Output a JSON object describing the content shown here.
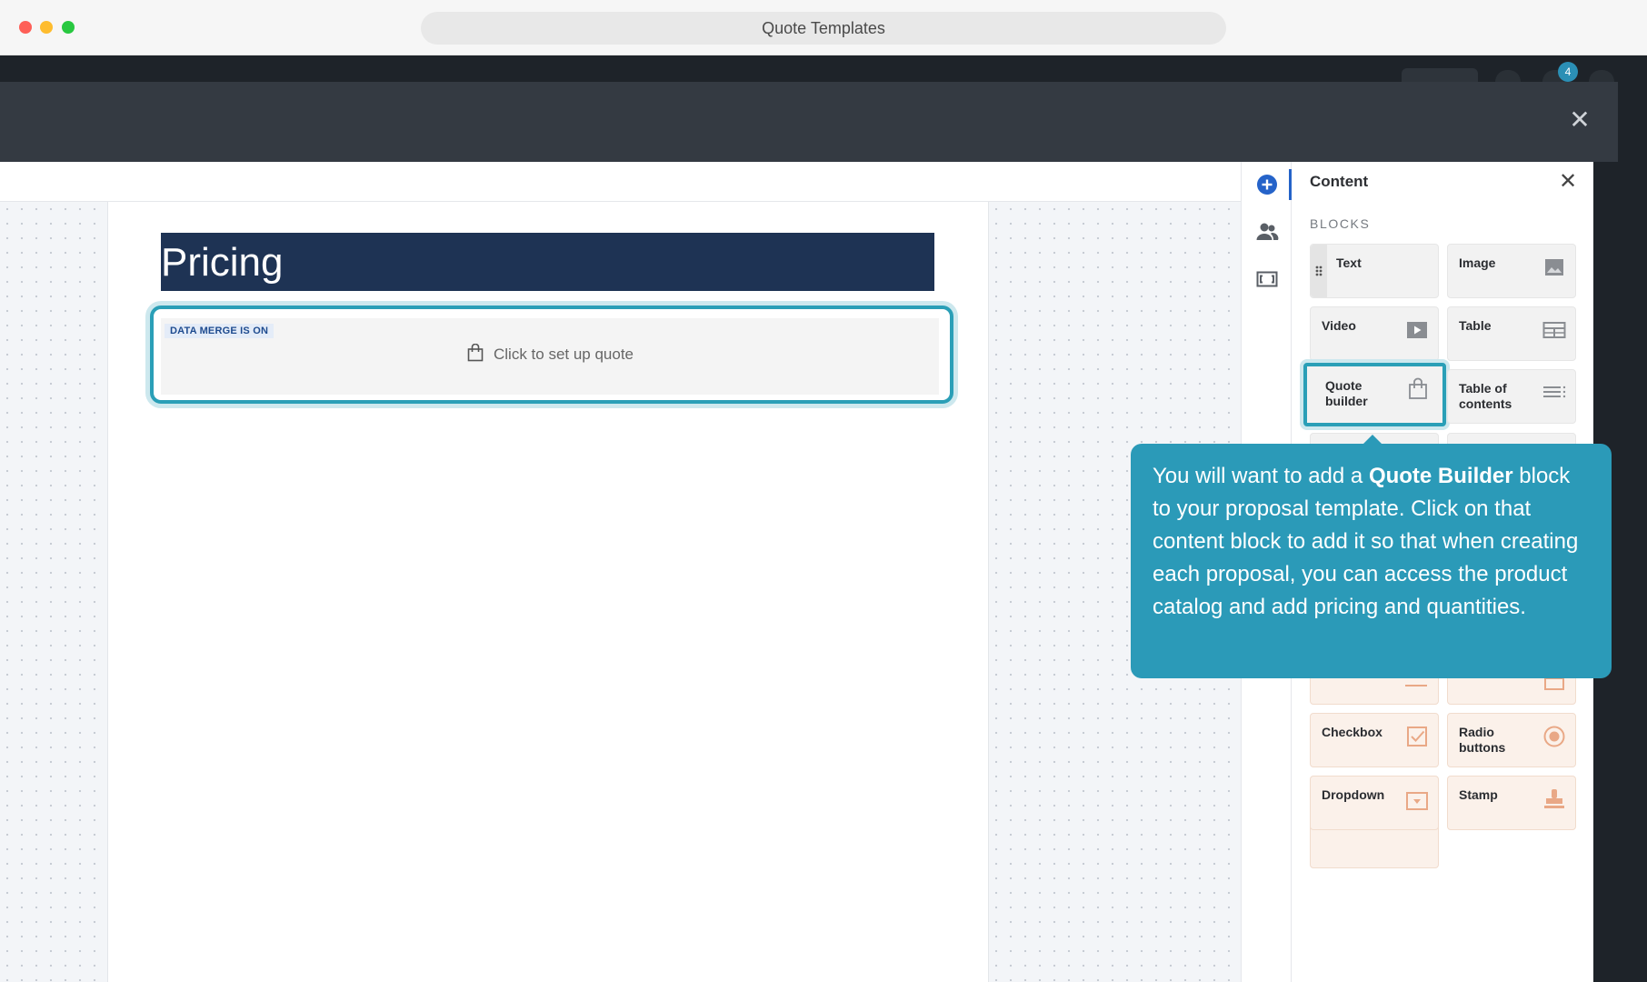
{
  "window": {
    "title": "Quote Templates"
  },
  "app_header": {
    "notification_count": "4"
  },
  "editor": {
    "pricing_heading": "Pricing",
    "quote_block": {
      "tag": "DATA MERGE IS ON",
      "cta": "Click to set up quote"
    }
  },
  "panel": {
    "title": "Content",
    "section": "BLOCKS",
    "blocks": [
      {
        "label": "Text",
        "icon": "drag-handle-icon"
      },
      {
        "label": "Image",
        "icon": "image-icon"
      },
      {
        "label": "Video",
        "icon": "video-icon"
      },
      {
        "label": "Table",
        "icon": "table-icon"
      },
      {
        "label": "Quote builder",
        "icon": "shopping-bag-icon"
      },
      {
        "label": "Table of contents",
        "icon": "list-icon"
      },
      {
        "label": "Checkbox",
        "icon": "checkbox-icon"
      },
      {
        "label": "Radio buttons",
        "icon": "radio-icon"
      },
      {
        "label": "Dropdown",
        "icon": "dropdown-icon"
      },
      {
        "label": "Stamp",
        "icon": "stamp-icon"
      }
    ]
  },
  "tooltip": {
    "text_before": "You will want to add a ",
    "bold": "Quote Builder",
    "text_after": " block to your proposal template. Click on that content block to add it so that when creating each proposal, you can access the product catalog and add pricing and quantities."
  },
  "colors": {
    "accent_teal": "#2a9fb7",
    "tooltip_bg": "#2b9ab8",
    "banner_navy": "#1e3354",
    "rail_active_blue": "#2563c9"
  }
}
